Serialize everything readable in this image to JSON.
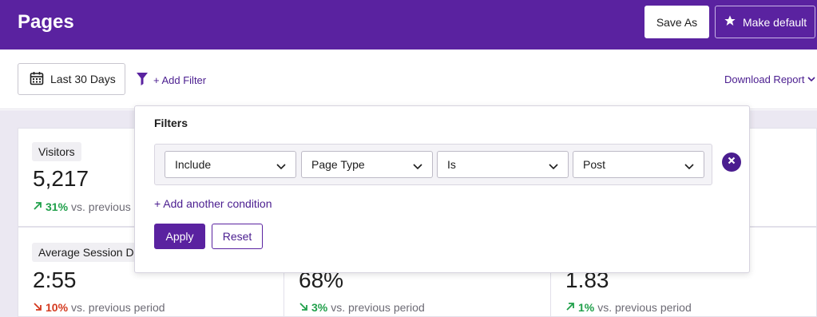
{
  "header": {
    "title": "Pages",
    "save_as_label": "Save As",
    "make_default_label": "Make default"
  },
  "toolbar": {
    "date_range_label": "Last 30 Days",
    "add_filter_label": "+ Add Filter",
    "download_label": "Download Report"
  },
  "filters": {
    "title": "Filters",
    "condition": {
      "mode": "Include",
      "field": "Page Type",
      "operator": "Is",
      "value": "Post"
    },
    "add_condition_label": "+ Add another condition",
    "apply_label": "Apply",
    "reset_label": "Reset"
  },
  "metrics": [
    {
      "label": "Visitors",
      "value": "5,217",
      "change": "31%",
      "direction": "up",
      "comparison": "vs. previous"
    },
    {
      "label": "Average Session Du",
      "value": "2:55",
      "change": "10%",
      "direction": "down",
      "comparison": "vs. previous period"
    },
    {
      "label": "",
      "value": "68%",
      "change": "3%",
      "direction": "down",
      "comparison": "vs. previous period"
    },
    {
      "label": "",
      "value": "1.83",
      "change": "1%",
      "direction": "up",
      "comparison": "vs. previous period"
    }
  ],
  "colors": {
    "brand": "#5a22a0",
    "link": "#4a1d8f",
    "positive": "#21a04b",
    "negative": "#d43a1f",
    "content_bg": "#ebe8f2"
  },
  "icons": {
    "date": "calendar-icon",
    "filter": "funnel-icon",
    "download": "chevron-down-icon",
    "default": "star-icon",
    "remove": "close-circle-icon"
  }
}
